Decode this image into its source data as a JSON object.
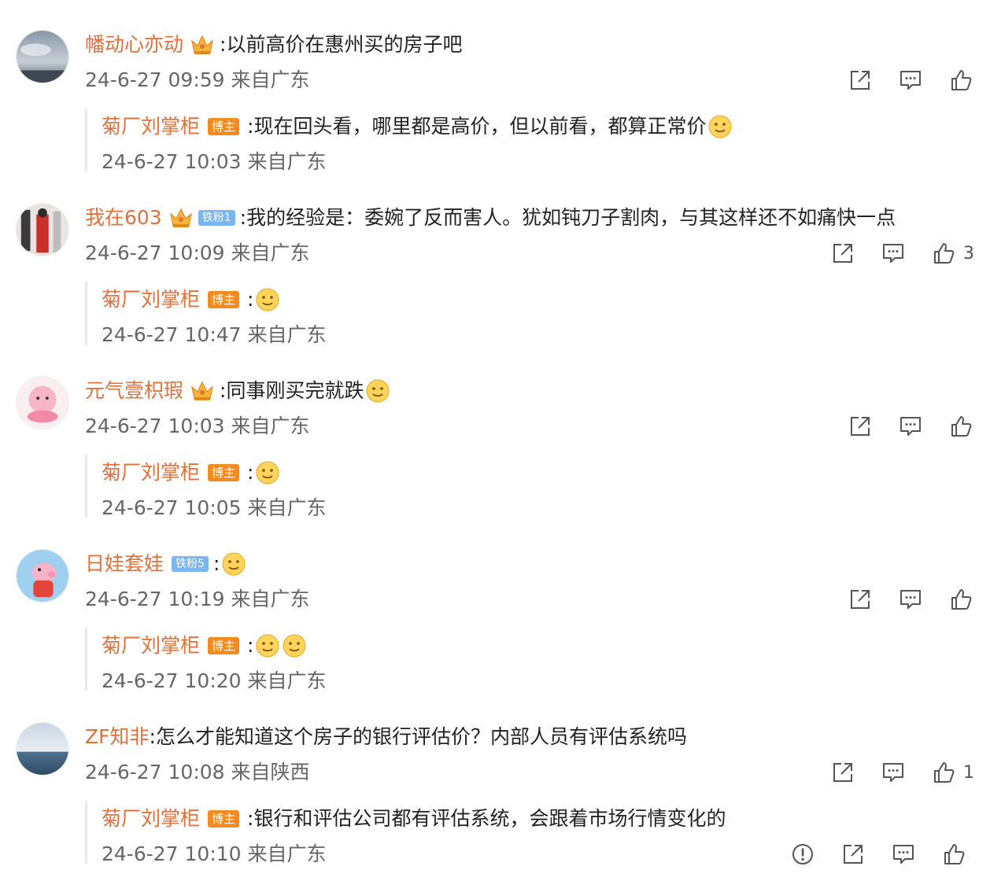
{
  "comments": [
    {
      "user": "幡动心亦动",
      "text": "以前高价在惠州买的房子吧",
      "time": "24-6-27 09:59 来自广东",
      "like_count": "",
      "reply": {
        "user": "菊厂刘掌柜",
        "badge": "博主",
        "text": "现在回头看，哪里都是高价，但以前看，都算正常价",
        "time": "24-6-27 10:03 来自广东"
      }
    },
    {
      "user": "我在603",
      "fan_badge": "铁粉1",
      "text": "我的经验是：委婉了反而害人。犹如钝刀子割肉，与其这样还不如痛快一点",
      "time": "24-6-27 10:09 来自广东",
      "like_count": "3",
      "reply": {
        "user": "菊厂刘掌柜",
        "badge": "博主",
        "text": "",
        "time": "24-6-27 10:47 来自广东"
      }
    },
    {
      "user": "元气壹枳瑕",
      "text": "同事刚买完就跌",
      "time": "24-6-27 10:03 来自广东",
      "like_count": "",
      "reply": {
        "user": "菊厂刘掌柜",
        "badge": "博主",
        "text": "",
        "time": "24-6-27 10:05 来自广东"
      }
    },
    {
      "user": "日娃套娃",
      "fan_badge": "铁粉5",
      "text": "",
      "time": "24-6-27 10:19 来自广东",
      "like_count": "",
      "reply": {
        "user": "菊厂刘掌柜",
        "badge": "博主",
        "text": "",
        "time": "24-6-27 10:20 来自广东"
      }
    },
    {
      "user": "ZF知非",
      "text": "怎么才能知道这个房子的银行评估价？内部人员有评估系统吗",
      "time": "24-6-27 10:08 来自陕西",
      "like_count": "1",
      "reply": {
        "user": "菊厂刘掌柜",
        "badge": "博主",
        "text": "银行和评估公司都有评估系统，会跟着市场行情变化的",
        "time": "24-6-27 10:10 来自广东"
      }
    }
  ],
  "colors": {
    "username": "#e2703a",
    "host_badge": "#f58a1f",
    "fan_badge": "#7ab6f2",
    "meta_text": "#666666"
  },
  "icons": [
    "share-icon",
    "comment-icon",
    "like-icon",
    "report-icon",
    "crown-icon",
    "emoji-icon"
  ]
}
